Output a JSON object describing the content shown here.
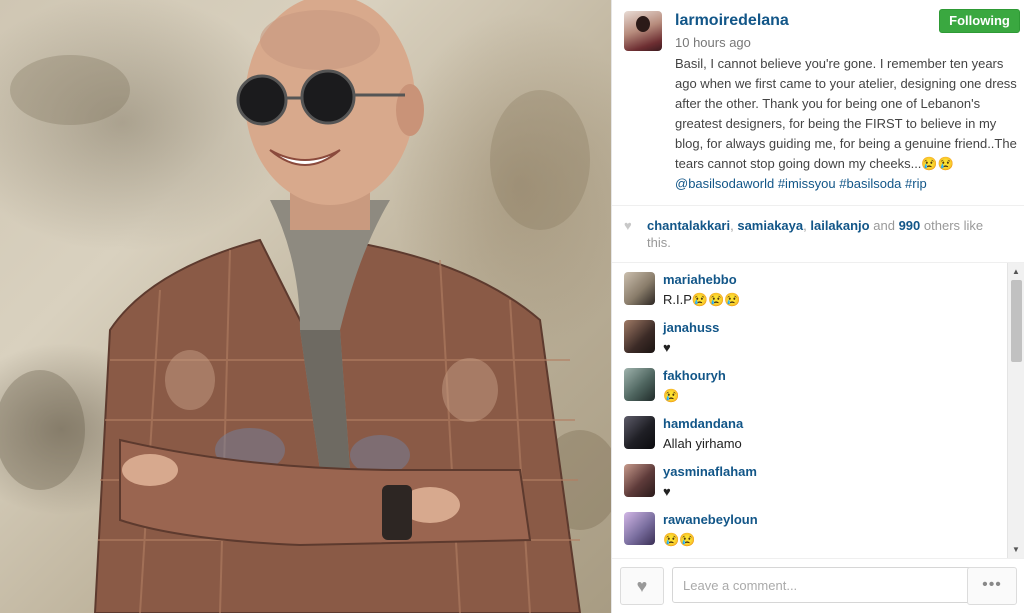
{
  "post": {
    "username": "larmoiredelana",
    "time": "10 hours ago",
    "follow_label": "Following",
    "caption_text": "Basil, I cannot believe you're gone. I remember ten years ago when we first came to your atelier, designing one dress after the other. Thank you for being one of Lebanon's greatest designers, for being the FIRST to believe in my blog, for always guiding me, for being a genuine friend..The tears cannot stop going down my cheeks...",
    "caption_emoji": "😢😢",
    "caption_tags": [
      "@basilsodaworld",
      "#imissyou",
      "#basilsoda",
      "#rip"
    ]
  },
  "likes": {
    "users": [
      "chantalakkari",
      "samiakaya",
      "lailakanjo"
    ],
    "and_text": "and",
    "count": "990",
    "suffix": "others like this."
  },
  "comments": [
    {
      "user": "mariahebbo",
      "text": "R.I.P😢😢😢",
      "avatar_color": "#8a7d6b"
    },
    {
      "user": "janahuss",
      "text": "♥",
      "avatar_color": "#3b2a26"
    },
    {
      "user": "fakhouryh",
      "text": "😢",
      "avatar_color": "#4f6660"
    },
    {
      "user": "hamdandana",
      "text": "Allah yirhamo",
      "avatar_color": "#1f1f25"
    },
    {
      "user": "yasminaflaham",
      "text": "♥",
      "avatar_color": "#5e3b3a"
    },
    {
      "user": "rawanebeyloun",
      "text": "😢😢",
      "avatar_color": "#7b6fa0"
    }
  ],
  "footer": {
    "like_icon": "heart-icon",
    "comment_placeholder": "Leave a comment...",
    "more_label": "•••"
  },
  "colors": {
    "link": "#125688",
    "follow_green": "#3aa840"
  }
}
